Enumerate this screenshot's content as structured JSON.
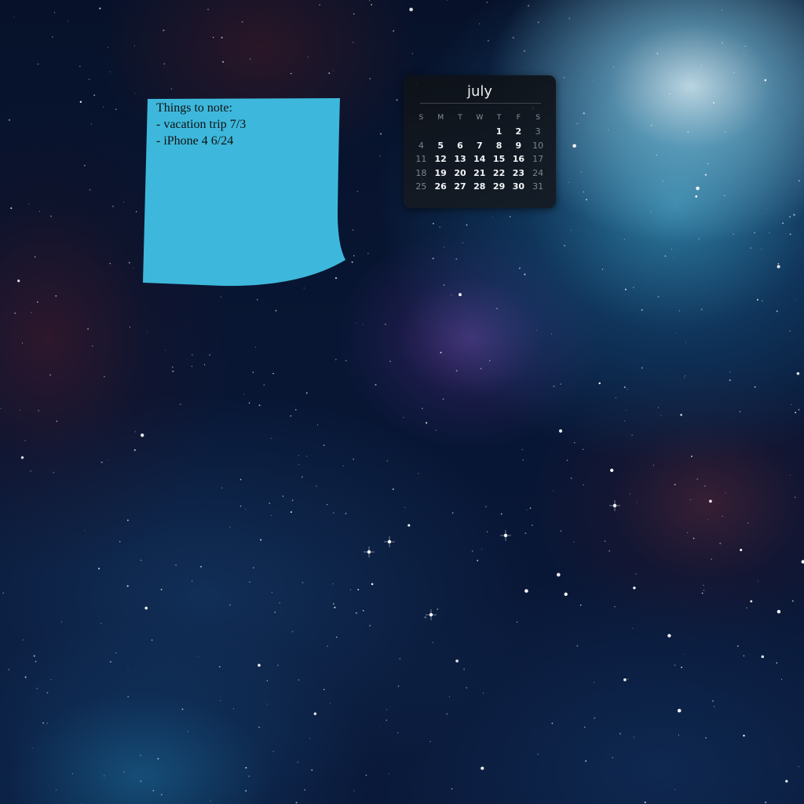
{
  "sticky_note": {
    "lines": [
      "Things to note:",
      "- vacation trip 7/3",
      "- iPhone 4 6/24"
    ],
    "color": "#3db8dc"
  },
  "calendar": {
    "month": "july",
    "weekdays": [
      "S",
      "M",
      "T",
      "W",
      "T",
      "F",
      "S"
    ],
    "weeks": [
      [
        "",
        "",
        "",
        "",
        "1",
        "2",
        "3"
      ],
      [
        "4",
        "5",
        "6",
        "7",
        "8",
        "9",
        "10"
      ],
      [
        "11",
        "12",
        "13",
        "14",
        "15",
        "16",
        "17"
      ],
      [
        "18",
        "19",
        "20",
        "21",
        "22",
        "23",
        "24"
      ],
      [
        "25",
        "26",
        "27",
        "28",
        "29",
        "30",
        "31"
      ]
    ]
  },
  "wallpaper": {
    "colors": {
      "deep_space": "#07122a",
      "nebula_cyan": "#3ca0c8",
      "nebula_purple": "#784aaa",
      "nebula_red": "#6e2832"
    }
  }
}
